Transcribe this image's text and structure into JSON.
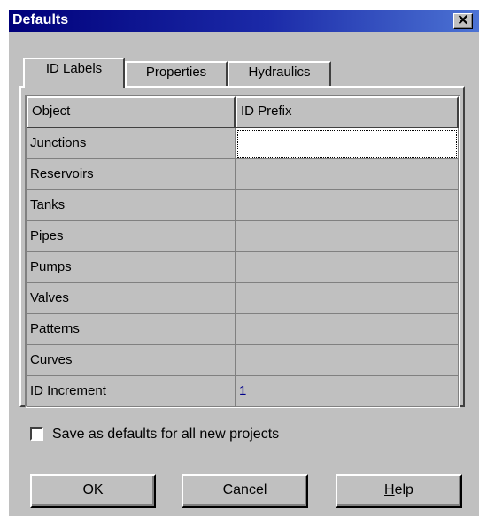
{
  "window": {
    "title": "Defaults",
    "close_glyph": "✕"
  },
  "tabs": [
    {
      "label": "ID Labels",
      "active": true
    },
    {
      "label": "Properties",
      "active": false
    },
    {
      "label": "Hydraulics",
      "active": false
    }
  ],
  "grid": {
    "headers": [
      "Object",
      "ID Prefix"
    ],
    "rows": [
      {
        "object": "Junctions",
        "value": ""
      },
      {
        "object": "Reservoirs",
        "value": ""
      },
      {
        "object": "Tanks",
        "value": ""
      },
      {
        "object": "Pipes",
        "value": ""
      },
      {
        "object": "Pumps",
        "value": ""
      },
      {
        "object": "Valves",
        "value": ""
      },
      {
        "object": "Patterns",
        "value": ""
      },
      {
        "object": "Curves",
        "value": ""
      },
      {
        "object": "ID Increment",
        "value": "1"
      }
    ]
  },
  "save_defaults": {
    "label": "Save as defaults for all new projects",
    "checked": false
  },
  "buttons": {
    "ok": "OK",
    "cancel": "Cancel",
    "help_underlined": "H",
    "help_rest": "elp"
  }
}
